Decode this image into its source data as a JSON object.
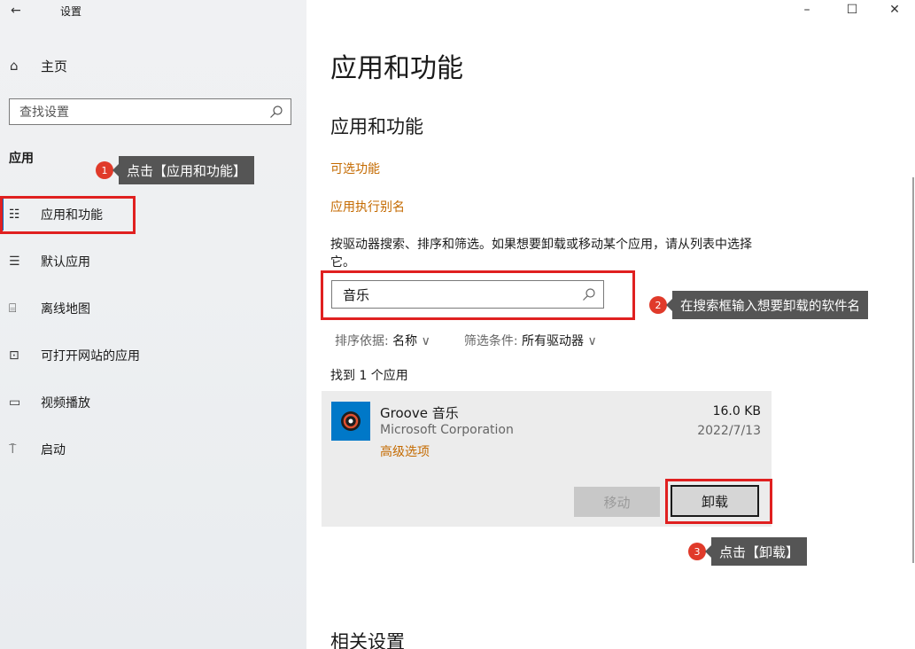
{
  "window": {
    "title": "设置",
    "back_icon": "←",
    "minimize": "–",
    "maximize": "☐",
    "close": "✕"
  },
  "sidebar": {
    "home_label": "主页",
    "search_placeholder": "查找设置",
    "section_label": "应用",
    "items": [
      {
        "label": "应用和功能",
        "icon": "apps-features-icon",
        "glyph": "☷",
        "selected": true
      },
      {
        "label": "默认应用",
        "icon": "default-apps-icon",
        "glyph": "☰"
      },
      {
        "label": "离线地图",
        "icon": "offline-maps-icon",
        "glyph": "⌸"
      },
      {
        "label": "可打开网站的应用",
        "icon": "apps-for-websites-icon",
        "glyph": "⊡"
      },
      {
        "label": "视频播放",
        "icon": "video-playback-icon",
        "glyph": "▭"
      },
      {
        "label": "启动",
        "icon": "startup-icon",
        "glyph": "⍑"
      }
    ]
  },
  "main": {
    "page_title": "应用和功能",
    "section_title": "应用和功能",
    "optional_features_link": "可选功能",
    "app_alias_link": "应用执行别名",
    "description": "按驱动器搜索、排序和筛选。如果想要卸载或移动某个应用，请从列表中选择它。",
    "search_value": "音乐",
    "sort_label": "排序依据:",
    "sort_value": "名称",
    "filter_label": "筛选条件:",
    "filter_value": "所有驱动器",
    "found_text": "找到 1 个应用",
    "app": {
      "name": "Groove 音乐",
      "publisher": "Microsoft Corporation",
      "advanced_options": "高级选项",
      "size": "16.0 KB",
      "date": "2022/7/13",
      "move_label": "移动",
      "uninstall_label": "卸载"
    },
    "related_settings": "相关设置"
  },
  "annotations": [
    {
      "number": "1",
      "text": "点击【应用和功能】"
    },
    {
      "number": "2",
      "text": "在搜索框输入想要卸载的软件名"
    },
    {
      "number": "3",
      "text": "点击【卸载】"
    }
  ],
  "colors": {
    "accent_link": "#c46a00",
    "highlight_box": "#e02020",
    "badge": "#e03a2a",
    "callout_bg": "#555555",
    "app_icon_bg": "#0078c8"
  }
}
